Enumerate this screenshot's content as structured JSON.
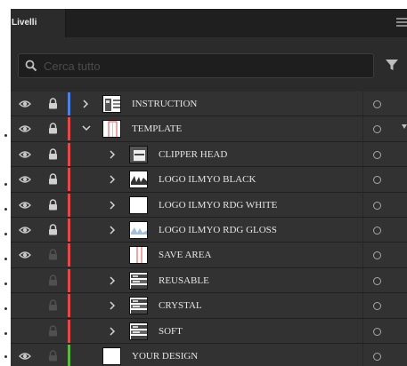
{
  "panel": {
    "tab_label": "Livelli",
    "search_placeholder": "Cerca tutto"
  },
  "colors": {
    "red": "#e24a4a",
    "blue": "#4e80e0",
    "green": "#5fb846",
    "panel_bg": "#2b2b2b",
    "row_bg": "#323232"
  },
  "layers": [
    {
      "name": "INSTRUCTION",
      "level": 0,
      "visible": true,
      "locked": true,
      "expanded": false,
      "has_children": true,
      "color": "blue",
      "thumb": "instruction"
    },
    {
      "name": "TEMPLATE",
      "level": 0,
      "visible": true,
      "locked": true,
      "expanded": true,
      "has_children": true,
      "color": "red",
      "thumb": "template"
    },
    {
      "name": "CLIPPER HEAD",
      "level": 1,
      "visible": true,
      "locked": true,
      "expanded": false,
      "has_children": true,
      "color": "red",
      "thumb": "clipper"
    },
    {
      "name": "LOGO ILMYO BLACK",
      "level": 1,
      "visible": true,
      "locked": true,
      "expanded": false,
      "has_children": true,
      "color": "red",
      "thumb": "logo-black"
    },
    {
      "name": "LOGO ILMYO RDG WHITE",
      "level": 1,
      "visible": true,
      "locked": true,
      "expanded": false,
      "has_children": true,
      "color": "red",
      "thumb": "blank"
    },
    {
      "name": "LOGO ILMYO RDG GLOSS",
      "level": 1,
      "visible": true,
      "locked": true,
      "expanded": false,
      "has_children": true,
      "color": "red",
      "thumb": "logo-gloss"
    },
    {
      "name": "SAVE AREA",
      "level": 1,
      "visible": true,
      "locked": false,
      "expanded": false,
      "has_children": false,
      "color": "red",
      "thumb": "save-area"
    },
    {
      "name": "REUSABLE",
      "level": 1,
      "visible": false,
      "locked": false,
      "expanded": false,
      "has_children": true,
      "color": "red",
      "thumb": "stack"
    },
    {
      "name": "CRYSTAL",
      "level": 1,
      "visible": false,
      "locked": false,
      "expanded": false,
      "has_children": true,
      "color": "red",
      "thumb": "stack"
    },
    {
      "name": "SOFT",
      "level": 1,
      "visible": false,
      "locked": false,
      "expanded": false,
      "has_children": true,
      "color": "red",
      "thumb": "stack"
    },
    {
      "name": "YOUR DESIGN",
      "level": 0,
      "visible": true,
      "locked": false,
      "expanded": false,
      "has_children": false,
      "color": "green",
      "thumb": "blank"
    }
  ]
}
